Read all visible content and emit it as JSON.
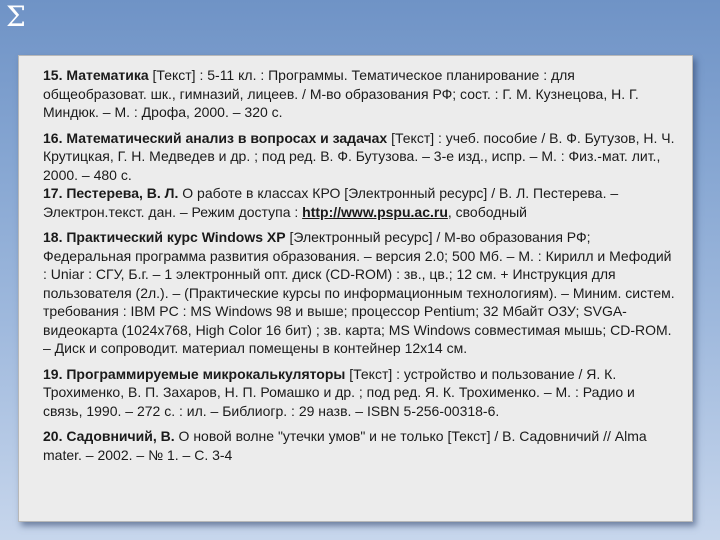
{
  "symbol": "Σ",
  "entries": [
    {
      "num": "15.",
      "title": "Математика",
      "text": " [Текст] : 5-11 кл. : Программы. Тематическое планирование : для общеобразоват. шк., гимназий, лицеев. / М-во образования РФ; сост. : Г. М. Кузнецова, Н. Г. Миндюк. – М. : Дрофа, 2000. – 320 с."
    },
    {
      "num": "16.",
      "title": "Математический анализ в вопросах и задачах",
      "text": " [Текст] : учеб. пособие / В. Ф. Бутузов, Н. Ч. Крутицкая, Г. Н. Медведев и др. ; под ред. В. Ф. Бутузова. – 3-е изд., испр. – М. : Физ.-мат. лит., 2000. – 480 с."
    },
    {
      "num": "17.",
      "title": "Пестерева, В. Л.",
      "text": " О работе в классах КРО [Электронный ресурс] / В. Л. Пестерева. – Электрон.текст. дан. – Режим доступа : ",
      "link": "http://www.pspu.ac.ru",
      "tail": ", свободный"
    },
    {
      "num": "18.",
      "title": "Практический курс Windows XP",
      "text": " [Электронный ресурс] / М-во образования РФ; Федеральная программа развития образования. – версия 2.0; 500 Мб. – М. : Кирилл и Мефодий : Uniar : СГУ, Б.г. – 1 электронный опт. диск (CD-ROM) : зв., цв.; 12 см. + Инструкция для пользователя (2л.). – (Практические курсы по информационным технологиям). – Миним. систем. требования : IBM PC : MS Windows 98 и выше; процессор Pentium; 32 Мбайт ОЗУ; SVGA-видеокарта (1024х768, High Color 16 бит) ; зв. карта; MS Windows совместимая мышь; CD-ROM. – Диск и сопроводит. материал помещены в  контейнер 12х14 см."
    },
    {
      "num": "19.",
      "title": "Программируемые микрокалькуляторы",
      "text": " [Текст] : устройство и пользование / Я. К. Трохименко, В. П. Захаров, Н. П. Ромашко и др. ; под ред. Я. К. Трохименко. – М. : Радио и связь, 1990. – 272 с. : ил. – Библиогр. : 29 назв. – ISBN 5-256-00318-6."
    },
    {
      "num": "20.",
      "title": "Садовничий, В.",
      "text": " О новой волне \"утечки умов\" и не только [Текст] / В. Садовничий // Alma mater. – 2002. – № 1. – С. 3-4"
    }
  ]
}
